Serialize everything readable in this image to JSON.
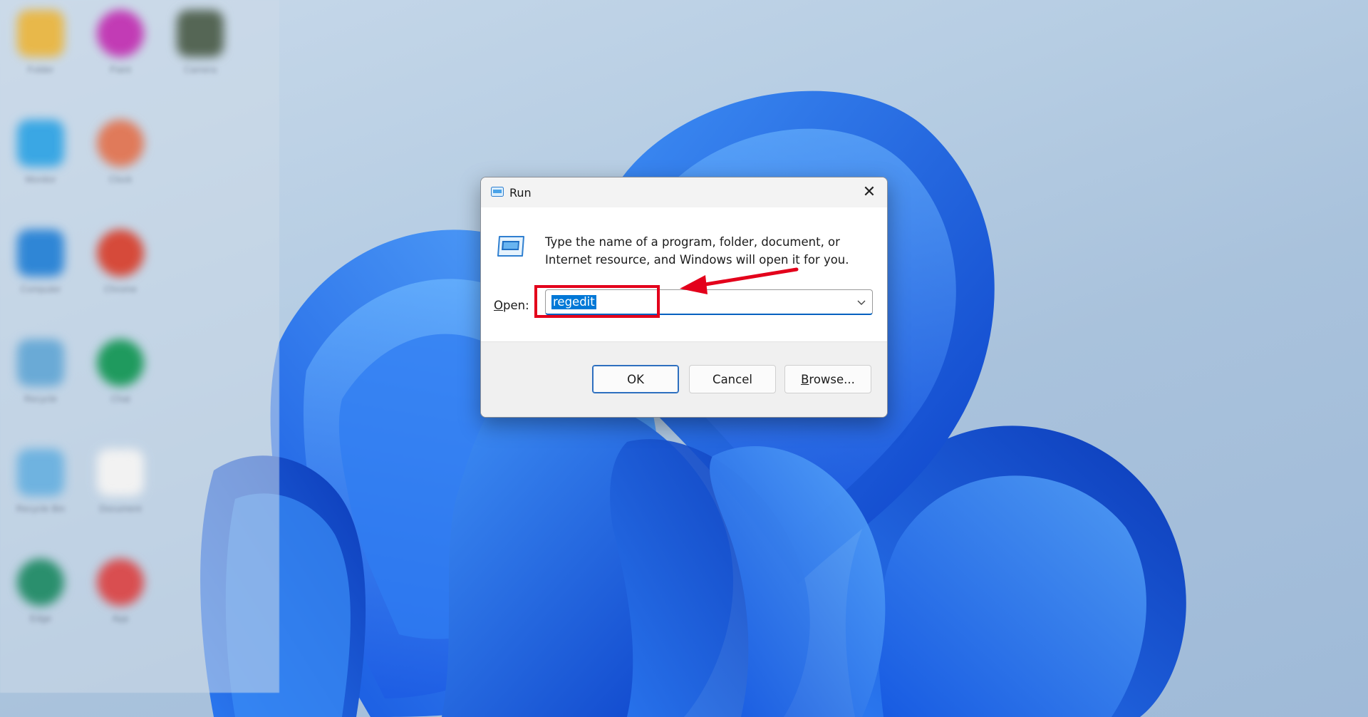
{
  "desktop": {
    "icons": [
      {
        "label": "Folder",
        "color": "#e8b84a"
      },
      {
        "label": "Paint",
        "color": "#c23bb5"
      },
      {
        "label": "Camera",
        "color": "#556655"
      },
      {
        "label": "Monitor",
        "color": "#3aa7e4"
      },
      {
        "label": "Clock",
        "color": "#e07a5a"
      },
      {
        "label": "Computer",
        "color": "#2f86d6"
      },
      {
        "label": "Chrome",
        "color": "#d64a3a"
      },
      {
        "label": "Recycle",
        "color": "#6aaad6"
      },
      {
        "label": "Chat",
        "color": "#1f9a5e"
      },
      {
        "label": "Recycle Bin",
        "color": "#6fb3e0"
      },
      {
        "label": "Document",
        "color": "#f2f2f2"
      },
      {
        "label": "Edge",
        "color": "#2a8f6d"
      },
      {
        "label": "App",
        "color": "#d94e50"
      }
    ]
  },
  "dialog": {
    "title": "Run",
    "description": "Type the name of a program, folder, document, or Internet resource, and Windows will open it for you.",
    "open_label_accel": "O",
    "open_label_rest": "pen:",
    "open_value": "regedit",
    "buttons": {
      "ok": "OK",
      "cancel": "Cancel",
      "browse_accel": "B",
      "browse_rest": "rowse..."
    },
    "icons": {
      "title": "run-icon",
      "close": "close-icon",
      "dropdown": "chevron-down-icon"
    }
  },
  "annotation": {
    "color": "#e3001b"
  }
}
